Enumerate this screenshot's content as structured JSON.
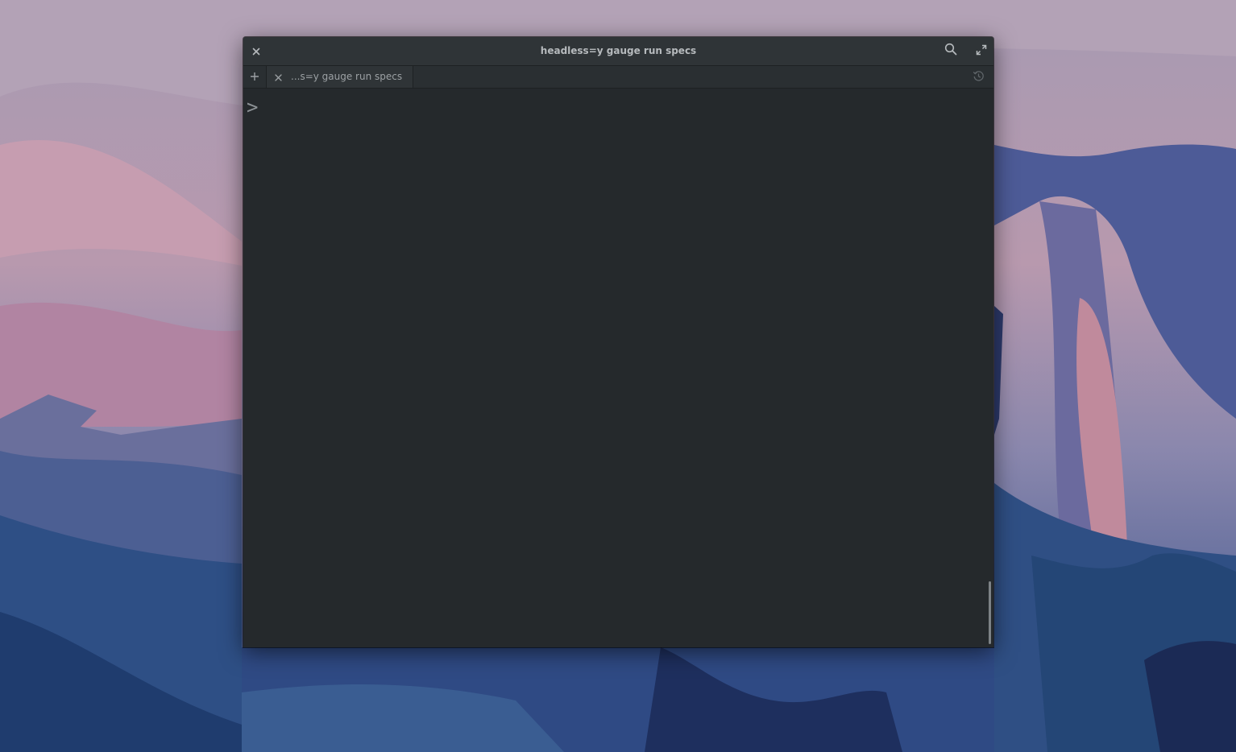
{
  "window": {
    "title": "headless=y gauge run specs"
  },
  "tabs": [
    {
      "label": "...s=y gauge run specs",
      "active": true
    }
  ],
  "terminal": {
    "prompt": ">"
  },
  "icons": {
    "close": "close-icon",
    "search": "search-icon",
    "maximize": "maximize-icon",
    "new_tab": "plus-icon",
    "tab_close": "close-icon",
    "history": "history-icon"
  },
  "colors": {
    "titlebar": "#2f3437",
    "terminal_bg": "#252a2d",
    "text": "#b6babd"
  }
}
